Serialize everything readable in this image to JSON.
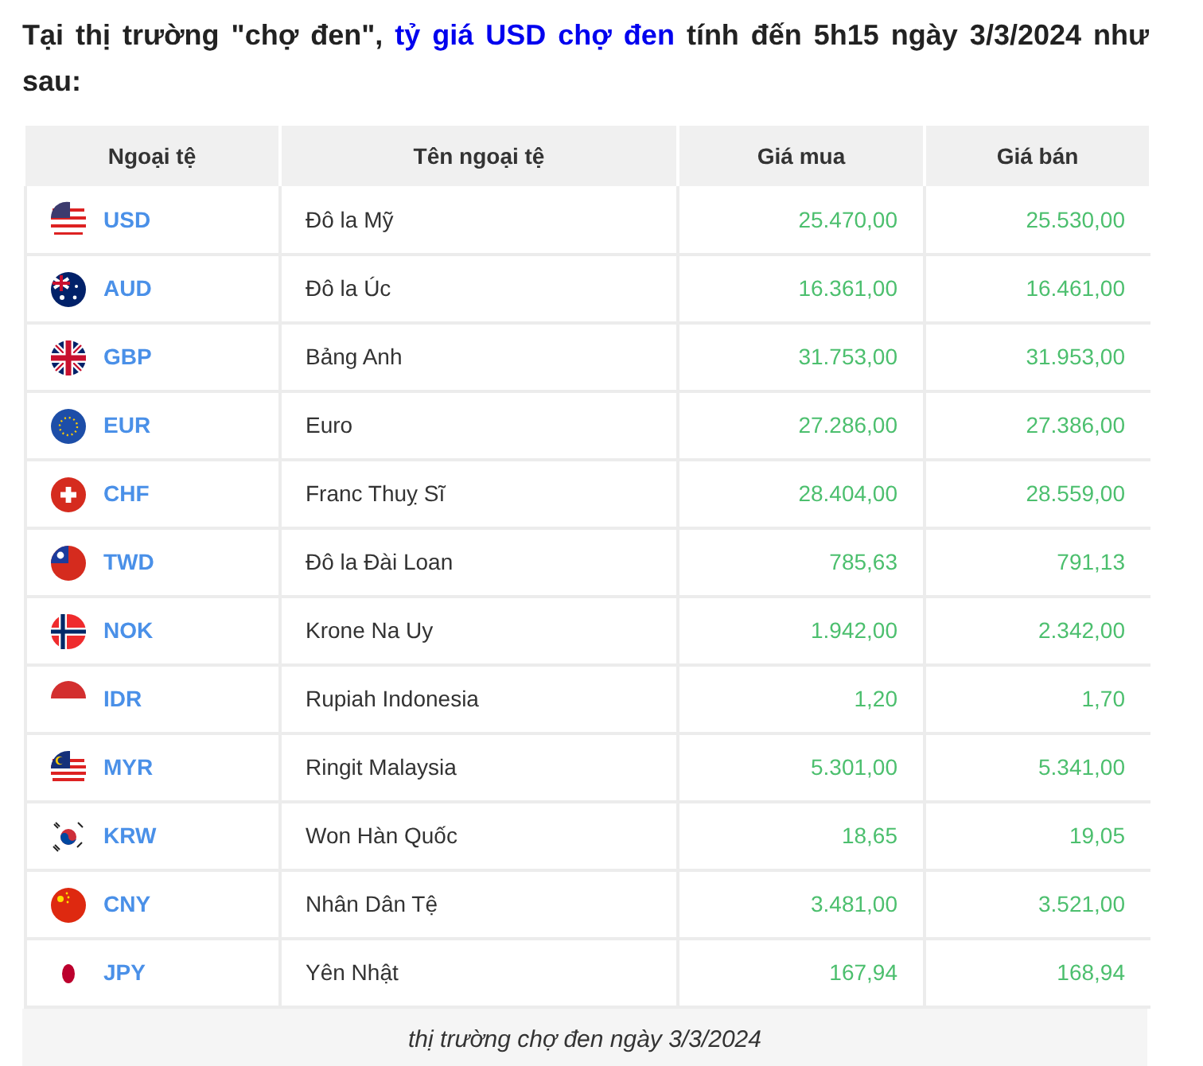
{
  "intro": {
    "before": "Tại thị trường \"chợ đen\", ",
    "link": "tỷ giá USD chợ đen",
    "after": " tính đến 5h15 ngày 3/3/2024 như sau:"
  },
  "table": {
    "columns": [
      "Ngoại tệ",
      "Tên ngoại tệ",
      "Giá mua",
      "Giá bán"
    ],
    "rows": [
      {
        "code": "USD",
        "name": "Đô la Mỹ",
        "buy": "25.470,00",
        "sell": "25.530,00"
      },
      {
        "code": "AUD",
        "name": "Đô la Úc",
        "buy": "16.361,00",
        "sell": "16.461,00"
      },
      {
        "code": "GBP",
        "name": "Bảng Anh",
        "buy": "31.753,00",
        "sell": "31.953,00"
      },
      {
        "code": "EUR",
        "name": "Euro",
        "buy": "27.286,00",
        "sell": "27.386,00"
      },
      {
        "code": "CHF",
        "name": "Franc Thuỵ Sĩ",
        "buy": "28.404,00",
        "sell": "28.559,00"
      },
      {
        "code": "TWD",
        "name": "Đô la Đài Loan",
        "buy": "785,63",
        "sell": "791,13"
      },
      {
        "code": "NOK",
        "name": "Krone Na Uy",
        "buy": "1.942,00",
        "sell": "2.342,00"
      },
      {
        "code": "IDR",
        "name": "Rupiah Indonesia",
        "buy": "1,20",
        "sell": "1,70"
      },
      {
        "code": "MYR",
        "name": "Ringit Malaysia",
        "buy": "5.301,00",
        "sell": "5.341,00"
      },
      {
        "code": "KRW",
        "name": "Won Hàn Quốc",
        "buy": "18,65",
        "sell": "19,05"
      },
      {
        "code": "CNY",
        "name": "Nhân Dân Tệ",
        "buy": "3.481,00",
        "sell": "3.521,00"
      },
      {
        "code": "JPY",
        "name": "Yên Nhật",
        "buy": "167,94",
        "sell": "168,94"
      }
    ]
  },
  "caption": "thị trường chợ đen ngày 3/3/2024"
}
